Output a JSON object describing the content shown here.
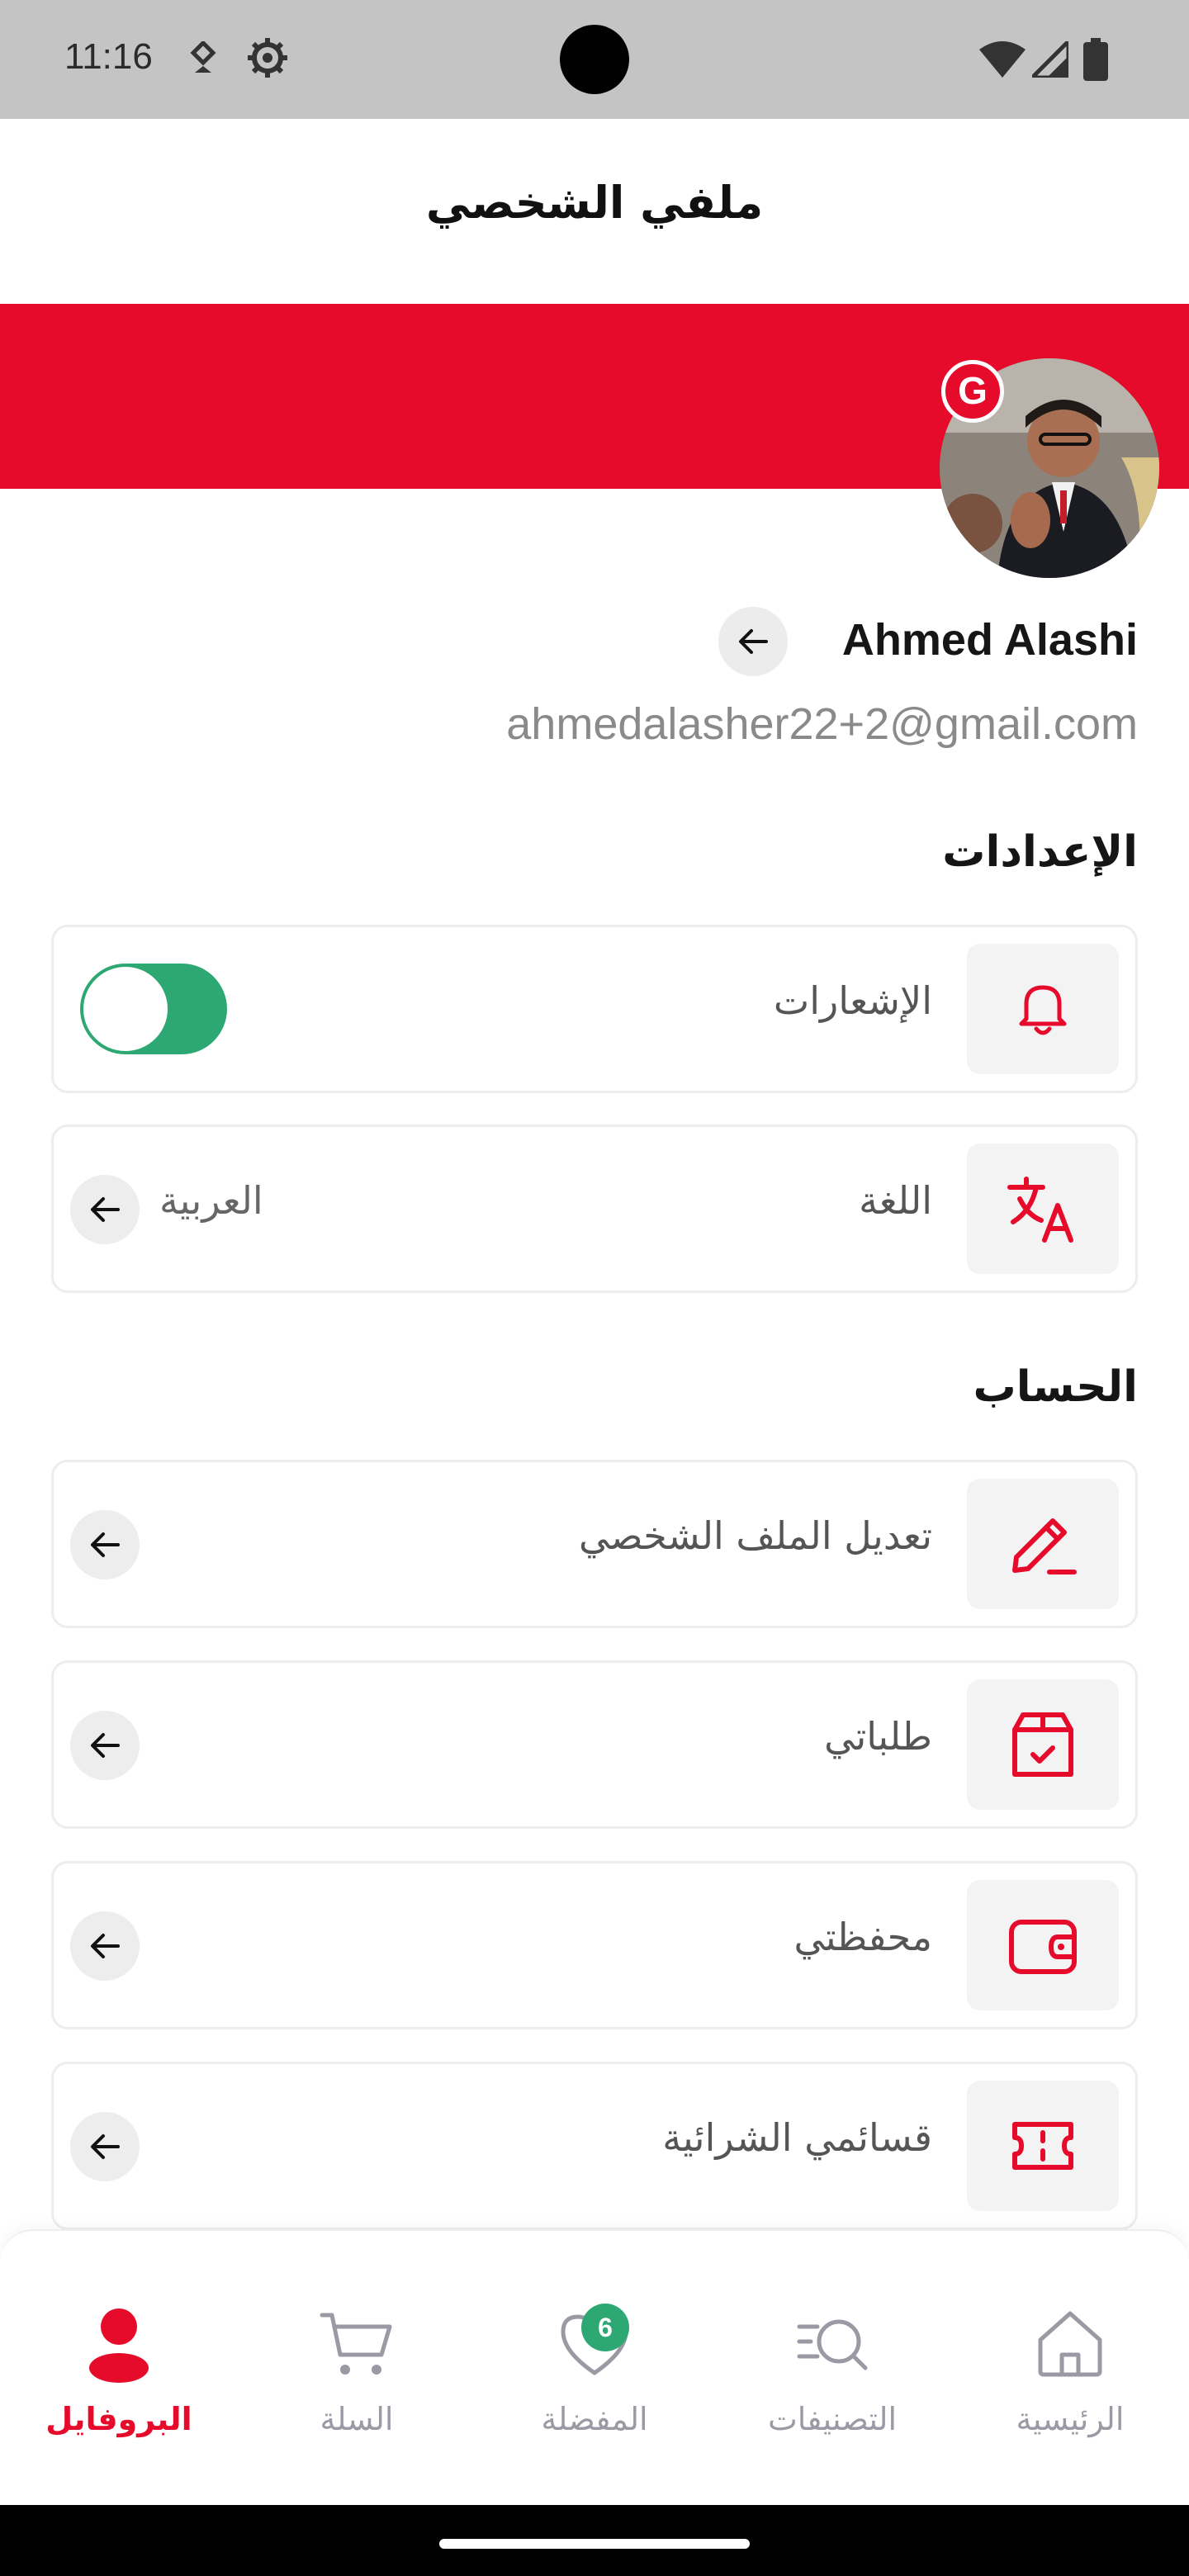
{
  "status_bar": {
    "time": "11:16"
  },
  "header": {
    "title": "ملفي الشخصي"
  },
  "profile": {
    "name": "Ahmed Alashi",
    "email": "ahmedalasher22+2@gmail.com",
    "login_provider_badge": "G"
  },
  "settings": {
    "title": "الإعدادات",
    "notifications_label": "الإشعارات",
    "notifications_enabled": true,
    "language_label": "اللغة",
    "language_value": "العربية"
  },
  "account": {
    "title": "الحساب",
    "items": [
      {
        "label": "تعديل الملف الشخصي",
        "icon": "edit-pen-icon"
      },
      {
        "label": "طلباتي",
        "icon": "order-box-icon"
      },
      {
        "label": "محفظتي",
        "icon": "wallet-icon"
      },
      {
        "label": "قسائمي الشرائية",
        "icon": "ticket-icon"
      }
    ]
  },
  "bottom_nav": {
    "items": [
      {
        "label": "البروفايل",
        "icon": "profile-icon",
        "active": true
      },
      {
        "label": "السلة",
        "icon": "cart-icon",
        "active": false
      },
      {
        "label": "المفضلة",
        "icon": "heart-icon",
        "active": false,
        "badge": "6"
      },
      {
        "label": "التصنيفات",
        "icon": "categories-search-icon",
        "active": false
      },
      {
        "label": "الرئيسية",
        "icon": "home-icon",
        "active": false
      }
    ]
  },
  "colors": {
    "brand": "#e60a2b",
    "toggle": "#2ea873",
    "icon_bg": "#f3f3f3"
  }
}
